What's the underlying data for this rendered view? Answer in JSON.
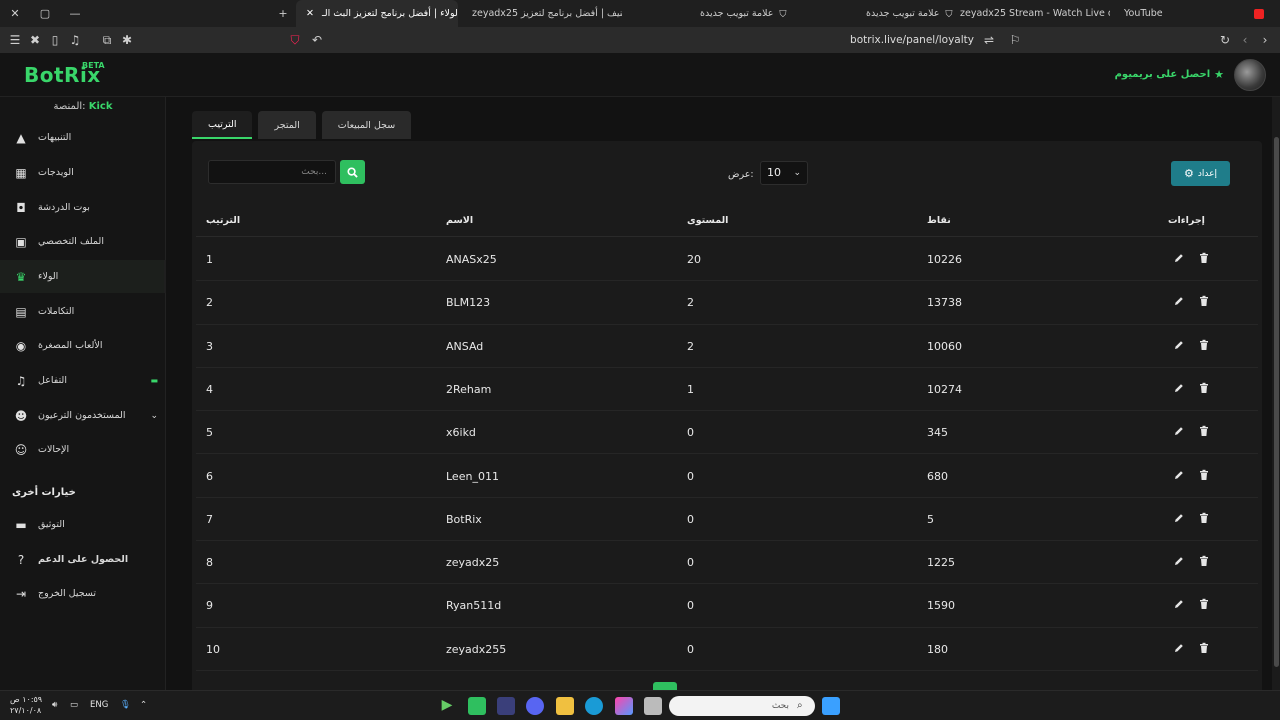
{
  "browser": {
    "tabs": [
      {
        "title": "الولاء | أفضل برنامج لتعزيز البث الـ",
        "active": true
      },
      {
        "title": "zeyadx25 تصنيف | أفضل برنامج لتعزيز",
        "active": false
      },
      {
        "title": "علامة تبويب جديدة",
        "active": false
      },
      {
        "title": "علامة تبويب جديدة",
        "active": false
      },
      {
        "title": "zeyadx25 Stream - Watch Live on Kick",
        "active": false
      },
      {
        "title": "YouTube",
        "active": false
      }
    ],
    "url": "botrix.live/panel/loyalty"
  },
  "app": {
    "logo": "BotRix",
    "beta": "BETA",
    "premium_label": "احصل على بريميوم",
    "platform_label": "المنصة:",
    "platform_value": "Kick"
  },
  "sidebar": {
    "items": [
      {
        "label": "التنبيهات",
        "icon": "warning-icon"
      },
      {
        "label": "الويدجات",
        "icon": "widgets-icon"
      },
      {
        "label": "بوت الدردشة",
        "icon": "robot-icon"
      },
      {
        "label": "الملف التخصصي",
        "icon": "id-card-icon"
      },
      {
        "label": "الولاء",
        "icon": "trophy-icon",
        "active": true
      },
      {
        "label": "التكاملات",
        "icon": "integration-icon"
      },
      {
        "label": "الألعاب المصغرة",
        "icon": "gamepad-icon"
      },
      {
        "label": "التفاعل",
        "icon": "music-icon"
      },
      {
        "label": "المستخدمون الترعيون",
        "icon": "users-icon"
      },
      {
        "label": "الإحالات",
        "icon": "referrals-icon"
      }
    ],
    "section_title": "خيارات أخرى",
    "other_items": [
      {
        "label": "التوثيق",
        "icon": "docs-icon"
      },
      {
        "label": "الحصول على الدعم",
        "icon": "help-icon"
      },
      {
        "label": "تسجيل الخروج",
        "icon": "logout-icon"
      }
    ]
  },
  "tabs": [
    {
      "label": "الترتيب",
      "active": true
    },
    {
      "label": "المتجر",
      "active": false
    },
    {
      "label": "سجل المبيعات",
      "active": false
    }
  ],
  "toolbar": {
    "search_placeholder": "بحث...",
    "show_label": "عرض:",
    "page_size": "10",
    "settings_label": "إعداد"
  },
  "table": {
    "headers": {
      "rank": "الترتيب",
      "name": "الاسم",
      "level": "المستوى",
      "points": "نقاط",
      "actions": "إجراءات"
    },
    "rows": [
      {
        "rank": "1",
        "name": "ANASx25",
        "level": "20",
        "points": "10226"
      },
      {
        "rank": "2",
        "name": "BLM123",
        "level": "2",
        "points": "13738"
      },
      {
        "rank": "3",
        "name": "ANSAd",
        "level": "2",
        "points": "10060"
      },
      {
        "rank": "4",
        "name": "2Reham",
        "level": "1",
        "points": "10274"
      },
      {
        "rank": "5",
        "name": "x6ikd",
        "level": "0",
        "points": "345"
      },
      {
        "rank": "6",
        "name": "Leen_011",
        "level": "0",
        "points": "680"
      },
      {
        "rank": "7",
        "name": "BotRix",
        "level": "0",
        "points": "5"
      },
      {
        "rank": "8",
        "name": "zeyadx25",
        "level": "0",
        "points": "1225"
      },
      {
        "rank": "9",
        "name": "Ryan511d",
        "level": "0",
        "points": "1590"
      },
      {
        "rank": "10",
        "name": "zeyadx255",
        "level": "0",
        "points": "180"
      }
    ]
  },
  "taskbar": {
    "search_placeholder": "بحث",
    "language": "ENG",
    "time": "١٠:٥٩ ص",
    "date": "٢٧/١٠/٠٨"
  },
  "colors": {
    "accent": "#39d66a",
    "settings_button": "#1f7d8a"
  }
}
